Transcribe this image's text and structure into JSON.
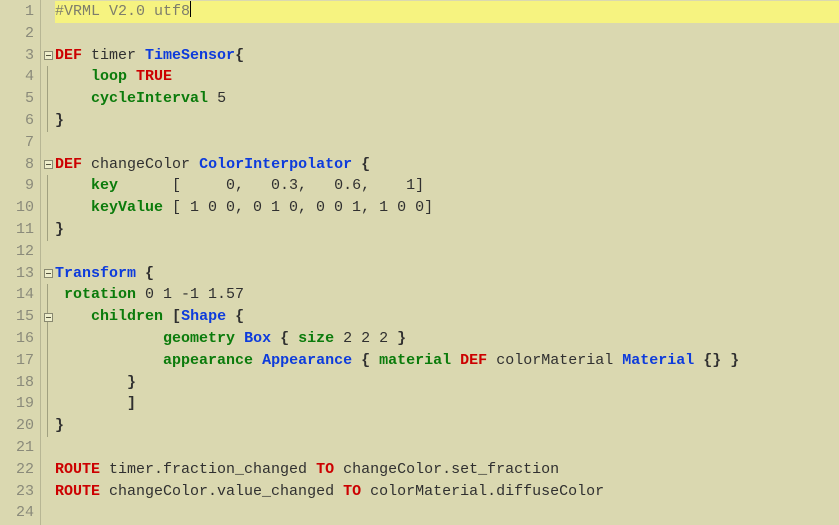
{
  "editor": {
    "line_count": 24,
    "current_line": 1,
    "fold_boxes": [
      3,
      8,
      13,
      15
    ],
    "fold_lines_from": 3,
    "fold_lines_to": 20
  },
  "code": {
    "l1": {
      "comment": "#VRML V2.0 utf8"
    },
    "l3": {
      "lead": "",
      "kw": "DEF",
      "sp1": " ",
      "ident": "timer ",
      "type": "TimeSensor",
      "punct": "{"
    },
    "l4": {
      "lead": "    ",
      "field": "loop",
      "sp": " ",
      "kw": "TRUE"
    },
    "l5": {
      "lead": "    ",
      "field": "cycleInterval",
      "sp": " ",
      "num": "5"
    },
    "l6": {
      "lead": "",
      "punct": "}"
    },
    "l8": {
      "lead": "",
      "kw": "DEF",
      "sp1": " ",
      "ident": "changeColor ",
      "type": "ColorInterpolator",
      "sp2": " ",
      "punct": "{"
    },
    "l9": {
      "lead": "    ",
      "field": "key",
      "rest": "      [     0,   0.3,   0.6,    1]"
    },
    "l10": {
      "lead": "    ",
      "field": "keyValue",
      "rest": " [ 1 0 0, 0 1 0, 0 0 1, 1 0 0]"
    },
    "l11": {
      "lead": "",
      "punct": "}"
    },
    "l13": {
      "lead": "",
      "type": "Transform",
      "sp": " ",
      "punct": "{"
    },
    "l14": {
      "lead": " ",
      "field": "rotation",
      "rest": " 0 1 -1 1.57"
    },
    "l15": {
      "lead": "    ",
      "field": "children",
      "sp": " ",
      "punct1": "[",
      "type": "Shape",
      "sp2": " ",
      "punct2": "{"
    },
    "l16": {
      "lead": "            ",
      "field": "geometry",
      "sp": " ",
      "type": "Box",
      "sp2": " ",
      "punct1": "{",
      "sp3": " ",
      "field2": "size",
      "rest": " 2 2 2 ",
      "punct2": "}"
    },
    "l17": {
      "lead": "            ",
      "field": "appearance",
      "sp": " ",
      "type": "Appearance",
      "sp2": " ",
      "punct1": "{",
      "sp3": " ",
      "field2": "material",
      "sp4": " ",
      "kw": "DEF",
      "sp5": " ",
      "ident": "colorMaterial ",
      "type2": "Material",
      "sp6": " ",
      "punct2": "{}",
      "sp7": " ",
      "punct3": "}"
    },
    "l18": {
      "lead": "        ",
      "punct": "}"
    },
    "l19": {
      "lead": "        ",
      "punct": "]"
    },
    "l20": {
      "lead": "",
      "punct": "}"
    },
    "l22": {
      "lead": "",
      "kw": "ROUTE",
      "sp": " ",
      "ident1": "timer.fraction_changed ",
      "kw2": "TO",
      "sp2": " ",
      "ident2": "changeColor.set_fraction"
    },
    "l23": {
      "lead": "",
      "kw": "ROUTE",
      "sp": " ",
      "ident1": "changeColor.value_changed ",
      "kw2": "TO",
      "sp2": " ",
      "ident2": "colorMaterial.diffuseColor"
    }
  }
}
